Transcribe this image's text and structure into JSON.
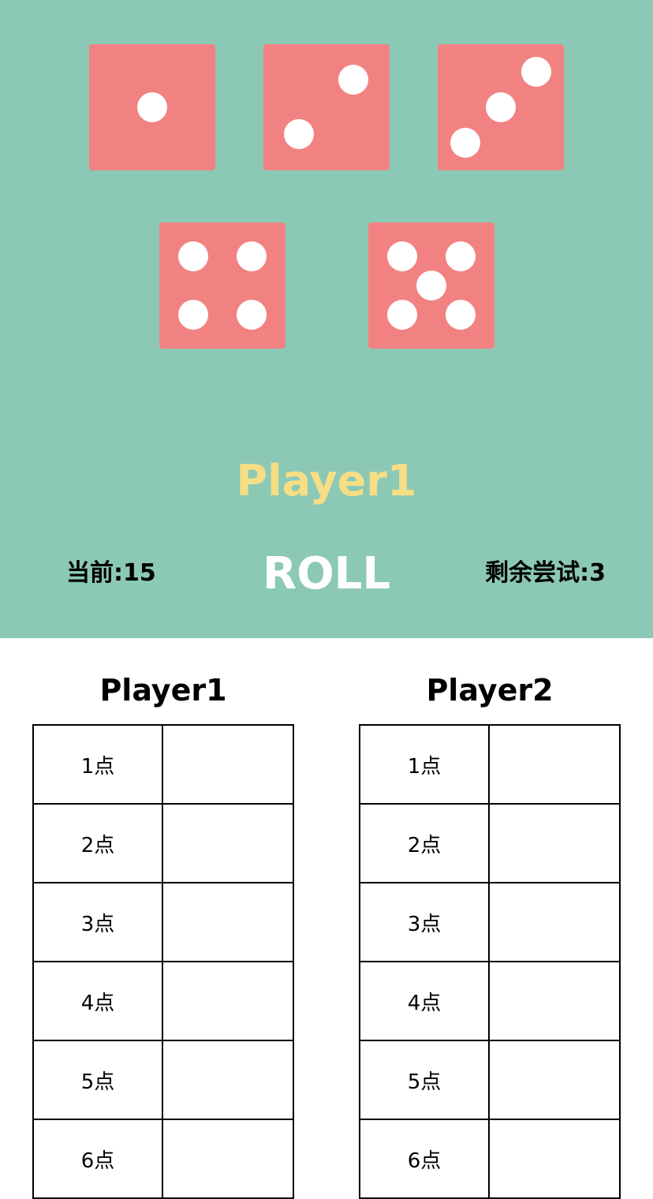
{
  "colors": {
    "game_background": "#8bc9b6",
    "die_face": "#f28282",
    "pip": "#ffffff",
    "current_player_text": "#f7dd84",
    "roll_text": "#ffffff"
  },
  "dice": [
    {
      "value": 1
    },
    {
      "value": 2
    },
    {
      "value": 3
    },
    {
      "value": 4
    },
    {
      "value": 5
    }
  ],
  "game": {
    "current_player": "Player1",
    "current_label": "当前:15",
    "roll_label": "ROLL",
    "remaining_label": "剩余尝试:3"
  },
  "scoreboard": {
    "players": [
      {
        "name": "Player1",
        "rows": [
          {
            "label": "1点",
            "value": ""
          },
          {
            "label": "2点",
            "value": ""
          },
          {
            "label": "3点",
            "value": ""
          },
          {
            "label": "4点",
            "value": ""
          },
          {
            "label": "5点",
            "value": ""
          },
          {
            "label": "6点",
            "value": ""
          }
        ]
      },
      {
        "name": "Player2",
        "rows": [
          {
            "label": "1点",
            "value": ""
          },
          {
            "label": "2点",
            "value": ""
          },
          {
            "label": "3点",
            "value": ""
          },
          {
            "label": "4点",
            "value": ""
          },
          {
            "label": "5点",
            "value": ""
          },
          {
            "label": "6点",
            "value": ""
          }
        ]
      }
    ]
  }
}
